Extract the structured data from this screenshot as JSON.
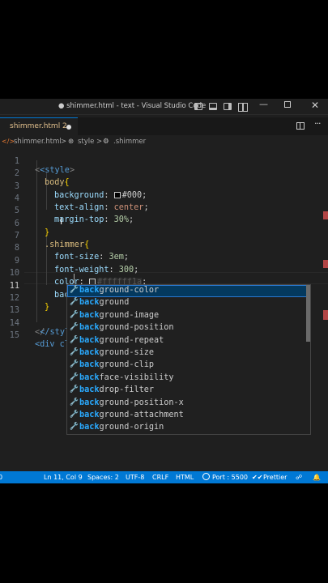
{
  "window": {
    "title": "● shimmer.html - text - Visual Studio Code"
  },
  "tabs": [
    {
      "label": "shimmer.html 2",
      "dirty": true,
      "color": "#e2c08d"
    }
  ],
  "breadcrumb": {
    "file": "shimmer.html",
    "separator": ">",
    "style": "style",
    "selector": ".shimmer"
  },
  "editor": {
    "active_line": 11,
    "line_numbers": [
      "1",
      "2",
      "3",
      "4",
      "5",
      "6",
      "7",
      "8",
      "9",
      "10",
      "11",
      "12",
      "13",
      "14",
      "15"
    ],
    "lines": {
      "l1": [
        "<style",
        ">"
      ],
      "l2": [
        "body",
        "{"
      ],
      "l3": [
        "background",
        ": ",
        "#000",
        ";"
      ],
      "l4": [
        "text-align",
        ": ",
        "center",
        ";"
      ],
      "l5": [
        "margin-top",
        ": ",
        "30",
        "%",
        ";"
      ],
      "l6": [
        "}"
      ],
      "l7": [
        ".shimmer",
        "{"
      ],
      "l8": [
        "font-size",
        ": ",
        "3",
        "em",
        ";"
      ],
      "l9": [
        "font-weight",
        ": ",
        "300",
        ";"
      ],
      "l10": [
        "color",
        ": ",
        "#ffffff1a",
        ";"
      ],
      "l11": [
        "back"
      ],
      "l12": [
        "}"
      ],
      "l13": [
        ""
      ],
      "l14": [
        "</style"
      ],
      "l15": [
        "<div cl"
      ]
    }
  },
  "suggestions": {
    "typed": "back",
    "selected_index": 0,
    "items": [
      {
        "match": "back",
        "rest": "ground-color"
      },
      {
        "match": "back",
        "rest": "ground"
      },
      {
        "match": "back",
        "rest": "ground-image"
      },
      {
        "match": "back",
        "rest": "ground-position"
      },
      {
        "match": "back",
        "rest": "ground-repeat"
      },
      {
        "match": "back",
        "rest": "ground-size"
      },
      {
        "match": "back",
        "rest": "ground-clip"
      },
      {
        "match": "back",
        "rest": "face-visibility"
      },
      {
        "match": "back",
        "rest": "drop-filter"
      },
      {
        "match": "back",
        "rest": "ground-position-x"
      },
      {
        "match": "back",
        "rest": "ground-attachment"
      },
      {
        "match": "back",
        "rest": "ground-origin"
      }
    ]
  },
  "statusbar": {
    "errors": "0",
    "position": "Ln 11, Col 9",
    "spaces": "Spaces: 2",
    "encoding": "UTF-8",
    "eol": "CRLF",
    "language": "HTML",
    "port": "Port : 5500",
    "prettier": "Prettier",
    "background_color": "#0078d4"
  },
  "icons": {
    "file_icon": "html-file-icon",
    "style_icon": "symbol-icon",
    "selector_icon": "symbol-class-icon",
    "suggest_icon": "wrench-property-icon"
  },
  "colors": {
    "editor_background": "#1f1f1f",
    "tag": "#569cd6",
    "selector": "#d7ba7d",
    "property": "#9cdcfe",
    "value": "#ce9178",
    "number": "#b5cea8",
    "match": "#2aaaff"
  }
}
